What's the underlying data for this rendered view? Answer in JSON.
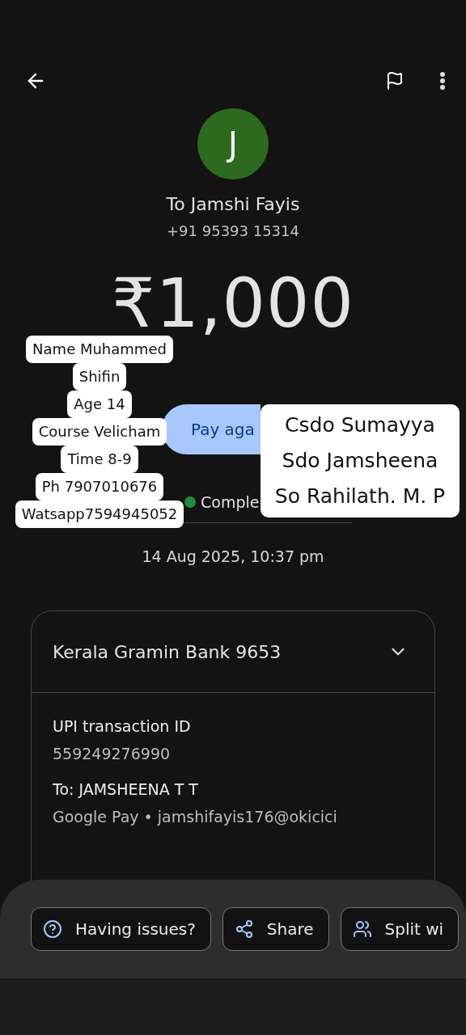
{
  "payee": {
    "initial": "J",
    "name": "To Jamshi Fayis",
    "phone": "+91 95393 15314"
  },
  "amount": "₹1,000",
  "pay_again_button": "Pay aga",
  "status": "Comple",
  "date": "14 Aug 2025, 10:37 pm",
  "bank_card": {
    "title": "Kerala Gramin Bank 9653",
    "expanded": true,
    "details": [
      {
        "label": "UPI transaction ID",
        "value": "559249276990"
      },
      {
        "label": "To: JAMSHEENA T T",
        "value": "Google Pay • jamshifayis176@okicici"
      }
    ]
  },
  "actions": [
    {
      "kind": "help",
      "label": "Having issues?"
    },
    {
      "kind": "share",
      "label": "Share"
    },
    {
      "kind": "split",
      "label": "Split wi"
    }
  ],
  "stickers": [
    {
      "lines": [
        "Name Muhammed",
        "Shifin",
        "Age 14",
        "Course Velicham",
        "Time 8-9",
        "Ph 7907010676",
        "Watsapp7594945052"
      ]
    },
    {
      "lines": [
        "Csdo Sumayya",
        "Sdo Jamsheena",
        "So Rahilath. M. P"
      ]
    }
  ]
}
